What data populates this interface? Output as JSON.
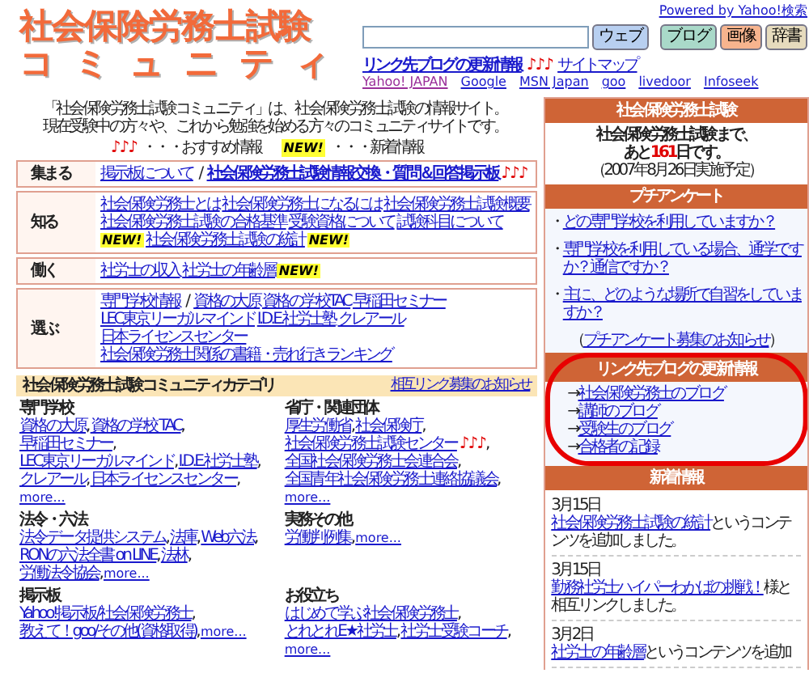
{
  "header": {
    "logo_lines": [
      "社会保険労務士試験",
      "コミュニティ"
    ],
    "powered": "Powered by Yahoo!検索",
    "search_buttons": [
      {
        "label": "ウェブ",
        "color": "#b8cff0"
      },
      {
        "label": "ブログ",
        "color": "#a9d9c9"
      },
      {
        "label": "画像",
        "color": "#f7b48e"
      },
      {
        "label": "辞書",
        "color": "#e6dbbd"
      }
    ],
    "blog_update_link": "リンク先ブログの更新情報",
    "notes": "♪♪♪",
    "sitemap": "サイトマップ",
    "engines": [
      {
        "label": "Yahoo! JAPAN",
        "visited": true
      },
      {
        "label": "Google",
        "visited": false
      },
      {
        "label": "MSN Japan",
        "visited": false
      },
      {
        "label": "goo",
        "visited": false
      },
      {
        "label": "livedoor",
        "visited": false
      },
      {
        "label": "Infoseek",
        "visited": false
      }
    ]
  },
  "intro": [
    "「社会保険労務士試験コミュニティ」は、社会保険労務士試験の情報サイト。",
    "現在受験中の方々や、これから勉強を始める方々のコミュニティサイトです。"
  ],
  "legend": [
    {
      "kind": "notes",
      "text": "♪♪♪"
    },
    {
      "kind": "text",
      "text": "・・・おすすめ情報"
    },
    {
      "kind": "new",
      "text": "NEW!"
    },
    {
      "kind": "text",
      "text": "・・・新着情報"
    }
  ],
  "rows": [
    {
      "label": "集まる",
      "items": [
        {
          "kind": "link",
          "text": "掲示板について"
        },
        {
          "kind": "slash",
          "text": "/"
        },
        {
          "kind": "bold_link",
          "text": "社会保険労務士試験情報交換・質問＆回答掲示板"
        },
        {
          "kind": "notes",
          "text": "♪♪♪"
        }
      ]
    },
    {
      "label": "知る",
      "items": [
        {
          "kind": "link",
          "text": "社会保険労務士とは"
        },
        {
          "kind": "link",
          "text": "社会保険労務士になるには"
        },
        {
          "kind": "link",
          "text": "社会保険労務士試験概要"
        },
        {
          "kind": "link",
          "text": "社会保険労務士試験の合格基準"
        },
        {
          "kind": "link",
          "text": "受験資格について"
        },
        {
          "kind": "link",
          "text": "試験科目について"
        },
        {
          "kind": "new",
          "text": "NEW!"
        },
        {
          "kind": "link",
          "text": "社会保険労務士試験の統計"
        },
        {
          "kind": "new",
          "text": "NEW!"
        }
      ]
    },
    {
      "label": "働く",
      "items": [
        {
          "kind": "link",
          "text": "社労士の収入"
        },
        {
          "kind": "link",
          "text": "社労士の年齢層"
        },
        {
          "kind": "new",
          "text": "NEW!"
        }
      ]
    },
    {
      "label": "選ぶ",
      "items": [
        {
          "kind": "link",
          "text": "専門学校情報"
        },
        {
          "kind": "slash",
          "text": "/"
        },
        {
          "kind": "link",
          "text": "資格の大原"
        },
        {
          "kind": "link",
          "text": "資格の学校TAC"
        },
        {
          "kind": "link",
          "text": "早稲田セミナー"
        },
        {
          "kind": "link",
          "text": "LEC東京リーガルマインド"
        },
        {
          "kind": "link",
          "text": "I.D.E.社労士塾"
        },
        {
          "kind": "link",
          "text": "クレアール"
        },
        {
          "kind": "link",
          "text": "日本ライセンスセンター"
        },
        {
          "kind": "link",
          "text": "社会保険労務士関係の書籍・売れ行きランキング"
        }
      ]
    }
  ],
  "categories": {
    "title": "社会保険労務士試験コミュニティカテゴリ",
    "notice_link": "相互リンク募集のお知らせ",
    "groups": [
      {
        "title": "専門学校",
        "items": [
          {
            "kind": "link",
            "text": "資格の大原",
            "after": ","
          },
          {
            "kind": "link",
            "text": "資格の学校 TAC",
            "after": ","
          },
          {
            "kind": "link",
            "text": "早稲田セミナー",
            "after": ","
          },
          {
            "kind": "link",
            "text": "LEC東京リーガルマインド",
            "after": ","
          },
          {
            "kind": "link",
            "text": "I.D.E.社労士塾",
            "after": ","
          },
          {
            "kind": "link",
            "text": "クレアール",
            "after": ","
          },
          {
            "kind": "link",
            "text": "日本ライセンスセンター",
            "after": ","
          },
          {
            "kind": "more",
            "text": "more..."
          }
        ]
      },
      {
        "title": "省庁・関連団体",
        "items": [
          {
            "kind": "link",
            "text": "厚生労働省",
            "after": ","
          },
          {
            "kind": "link",
            "text": "社会保険庁",
            "after": ","
          },
          {
            "kind": "link",
            "text": "社会保険労務士試験センター"
          },
          {
            "kind": "notes",
            "text": "♪♪♪",
            "after": ","
          },
          {
            "kind": "link",
            "text": "全国社会保険労務士会連合会",
            "after": ","
          },
          {
            "kind": "link",
            "text": "全国青年社会保険労務士連絡協議会",
            "after": ","
          },
          {
            "kind": "more",
            "text": "more..."
          }
        ]
      },
      {
        "title": "法令・六法",
        "items": [
          {
            "kind": "link",
            "text": "法令データ提供システム",
            "after": ","
          },
          {
            "kind": "link",
            "text": "法庫",
            "after": ","
          },
          {
            "kind": "link",
            "text": "Web六法",
            "after": ","
          },
          {
            "kind": "link",
            "text": "RONの六法全書 on LINE",
            "after": ","
          },
          {
            "kind": "link",
            "text": "法林",
            "after": ","
          },
          {
            "kind": "link",
            "text": "労働法令協会",
            "after": ","
          },
          {
            "kind": "more",
            "text": "more..."
          }
        ]
      },
      {
        "title": "実務その他",
        "items": [
          {
            "kind": "link",
            "text": "労働判例集",
            "after": ","
          },
          {
            "kind": "more",
            "text": "more..."
          }
        ]
      },
      {
        "title": "掲示板",
        "items": [
          {
            "kind": "link",
            "text": "Yahoo!掲示板/社会保険労務士",
            "after": ","
          },
          {
            "kind": "link",
            "text": "教えて！goo/その他(資格取得)",
            "after": ","
          },
          {
            "kind": "more",
            "text": "more..."
          }
        ]
      },
      {
        "title": "お役立ち",
        "items": [
          {
            "kind": "link",
            "text": "はじめて学ぶ社会保険労務士",
            "after": ","
          },
          {
            "kind": "link",
            "text": "とれとれE★社労士",
            "after": ","
          },
          {
            "kind": "link",
            "text": "社労士受験コーチ",
            "after": ","
          },
          {
            "kind": "more",
            "text": "more..."
          }
        ]
      }
    ]
  },
  "countdown": {
    "header": "社会保険労務士試験",
    "line1": "社会保険労務士試験まで、",
    "prefix": "あと",
    "days": "161",
    "suffix": "日です。",
    "date": "（2007年8月26日実施予定）"
  },
  "survey": {
    "header": "プチアンケート",
    "bullet": "・",
    "questions": [
      "どの専門学校を利用していますか？",
      "専門学校を利用している場合、通学ですか？通信ですか？",
      "主に、どのような場所で自習をしていますか？"
    ],
    "open": "（",
    "footer_link": "プチアンケート募集のお知らせ",
    "close": "）"
  },
  "blogs": {
    "header": "リンク先ブログの更新情報",
    "arrow": "→",
    "links": [
      "社会保険労務士のブログ",
      "講師のブログ",
      "受験生のブログ",
      "合格者の記録"
    ],
    "circled": true
  },
  "news": {
    "header": "新着情報",
    "entries": [
      {
        "date": "3月15日",
        "link": "社会保険労務士試験の統計",
        "rest": "というコンテンツを追加しました。"
      },
      {
        "date": "3月15日",
        "link": "勤務社労士ハイパーわかばの挑戦！",
        "rest": "様と相互リンクしました。"
      },
      {
        "date": "3月2日",
        "link": "社労士の年齢層",
        "rest": "というコンテンツを追加"
      }
    ]
  }
}
